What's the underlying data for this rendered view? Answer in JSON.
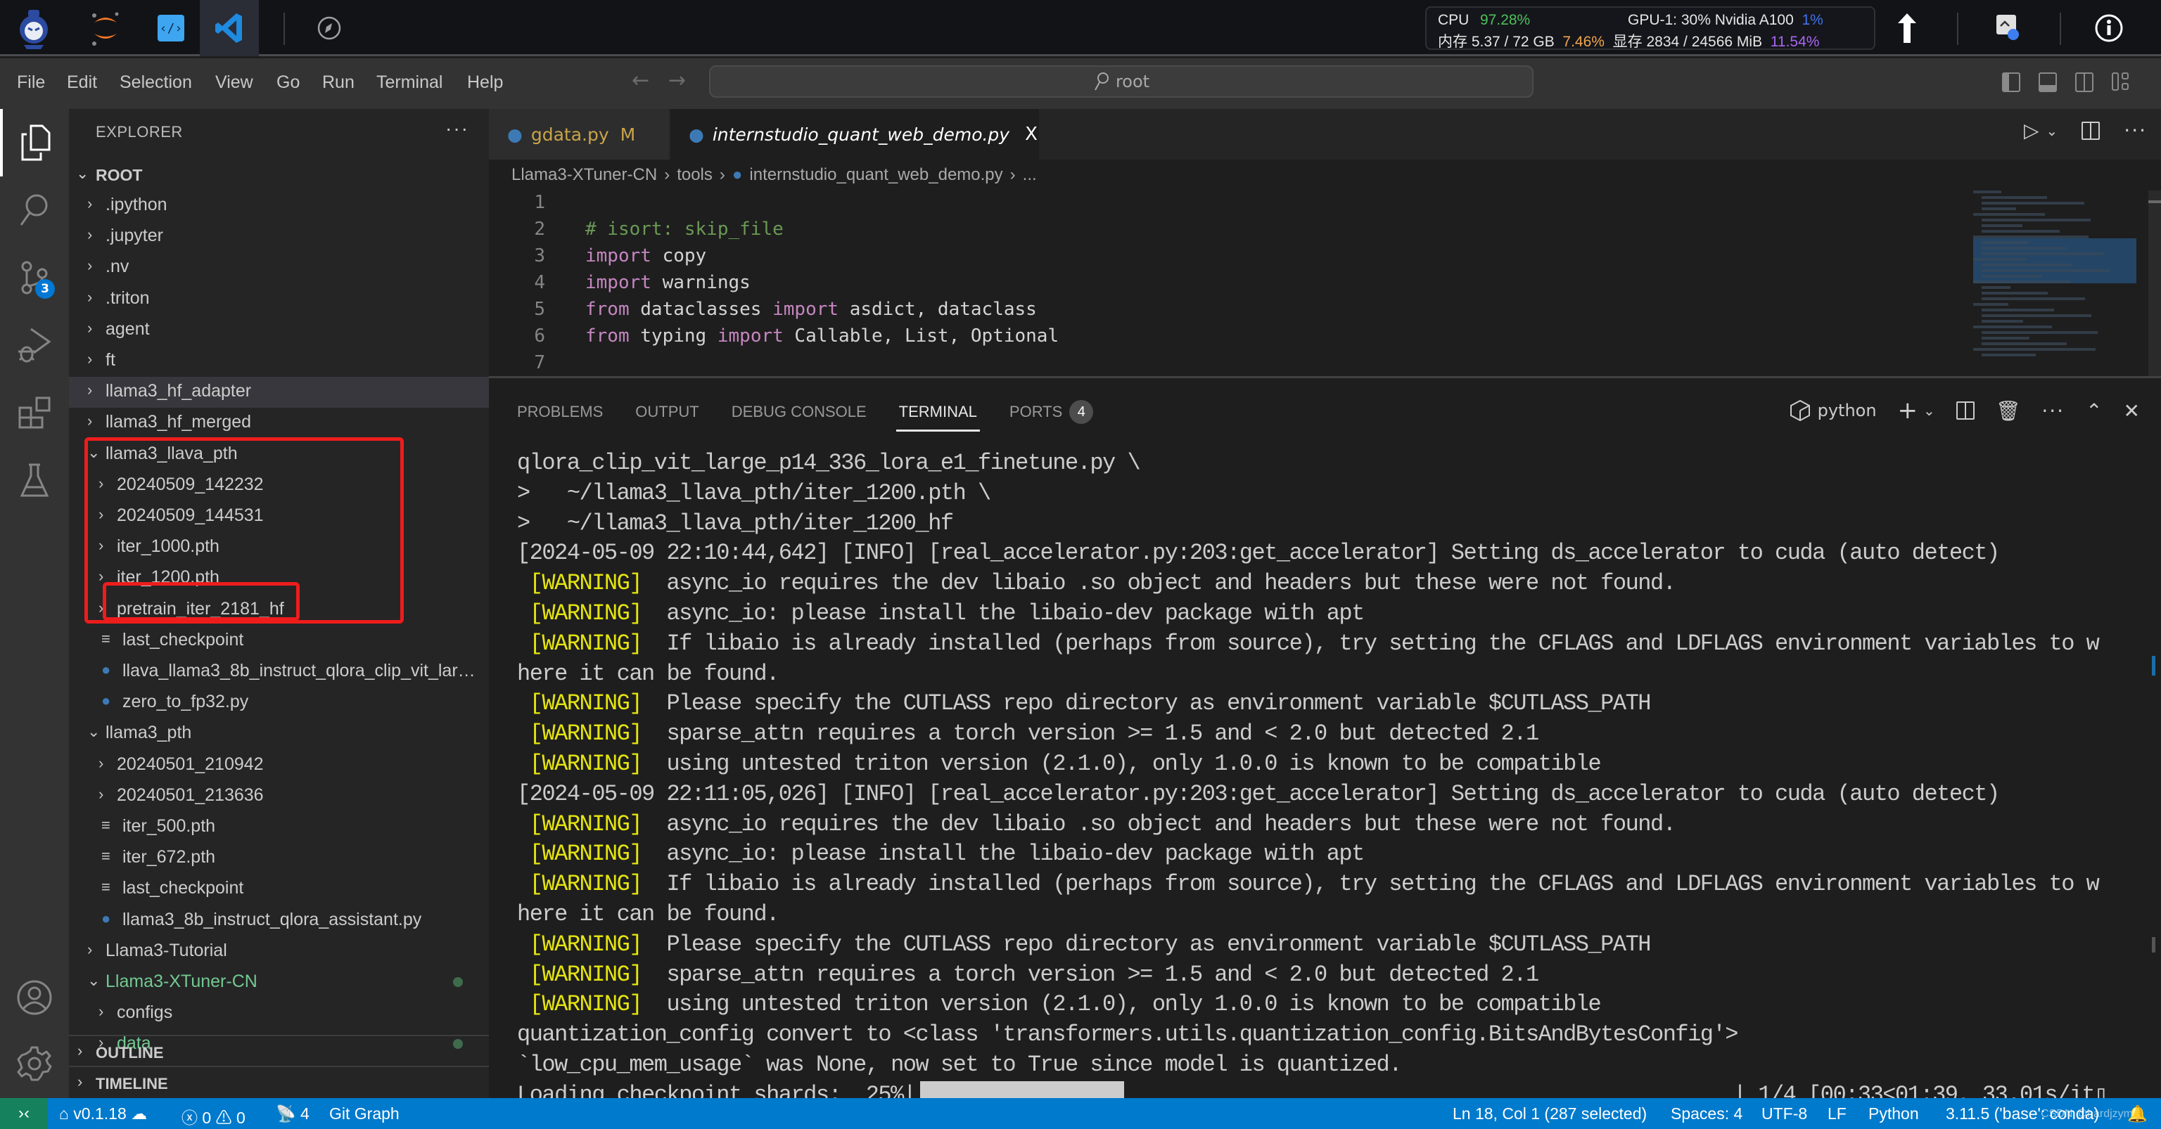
{
  "launcher": {
    "icons": [
      "internstudio-logo-icon",
      "jupyter-icon",
      "code-web-icon",
      "vscode-icon",
      "compass-icon"
    ],
    "active": "vscode-icon",
    "stats": {
      "cpu_label": "CPU",
      "cpu_value": "97.28%",
      "mem_label": "内存 5.37 / 72 GB",
      "mem_value": "7.46%",
      "gpu_label": "GPU-1: 30% Nvidia A100",
      "gpu_value": "1%",
      "vram_label": "显存 2834 / 24566 MiB",
      "vram_value": "11.54%"
    },
    "right_icons": [
      "tensorboard-icon",
      "monitor-icon",
      "info-icon"
    ],
    "colors": {
      "cpu": "#4cc05a",
      "mem": "#f0a64c",
      "gpu": "#3f74f0",
      "vram": "#a966f2"
    }
  },
  "menubar": {
    "items": [
      "File",
      "Edit",
      "Selection",
      "View",
      "Go",
      "Run",
      "Terminal",
      "Help"
    ],
    "search_text": "root"
  },
  "activity_bar": {
    "items": [
      "explorer",
      "search",
      "source-control",
      "run-debug",
      "extensions",
      "testing"
    ],
    "scm_badge": "3",
    "bottom": [
      "accounts",
      "manage"
    ]
  },
  "sidebar": {
    "title": "EXPLORER",
    "root_label": "ROOT",
    "tree": [
      {
        "label": ".ipython",
        "type": "folder",
        "depth": 1,
        "expanded": false
      },
      {
        "label": ".jupyter",
        "type": "folder",
        "depth": 1,
        "expanded": false
      },
      {
        "label": ".nv",
        "type": "folder",
        "depth": 1,
        "expanded": false
      },
      {
        "label": ".triton",
        "type": "folder",
        "depth": 1,
        "expanded": false
      },
      {
        "label": "agent",
        "type": "folder",
        "depth": 1,
        "expanded": false
      },
      {
        "label": "ft",
        "type": "folder",
        "depth": 1,
        "expanded": false
      },
      {
        "label": "llama3_hf_adapter",
        "type": "folder",
        "depth": 1,
        "expanded": false,
        "hover": true
      },
      {
        "label": "llama3_hf_merged",
        "type": "folder",
        "depth": 1,
        "expanded": false
      },
      {
        "label": "llama3_llava_pth",
        "type": "folder",
        "depth": 1,
        "expanded": true
      },
      {
        "label": "20240509_142232",
        "type": "folder",
        "depth": 2,
        "expanded": false
      },
      {
        "label": "20240509_144531",
        "type": "folder",
        "depth": 2,
        "expanded": false
      },
      {
        "label": "iter_1000.pth",
        "type": "folder",
        "depth": 2,
        "expanded": false
      },
      {
        "label": "iter_1200.pth",
        "type": "folder",
        "depth": 2,
        "expanded": false
      },
      {
        "label": "pretrain_iter_2181_hf",
        "type": "folder",
        "depth": 2,
        "expanded": false
      },
      {
        "label": "last_checkpoint",
        "type": "file",
        "depth": 2
      },
      {
        "label": "llava_llama3_8b_instruct_qlora_clip_vit_larg...",
        "type": "python",
        "depth": 2
      },
      {
        "label": "zero_to_fp32.py",
        "type": "python",
        "depth": 2
      },
      {
        "label": "llama3_pth",
        "type": "folder",
        "depth": 1,
        "expanded": true
      },
      {
        "label": "20240501_210942",
        "type": "folder",
        "depth": 2,
        "expanded": false
      },
      {
        "label": "20240501_213636",
        "type": "folder",
        "depth": 2,
        "expanded": false
      },
      {
        "label": "iter_500.pth",
        "type": "file",
        "depth": 2
      },
      {
        "label": "iter_672.pth",
        "type": "file",
        "depth": 2
      },
      {
        "label": "last_checkpoint",
        "type": "file",
        "depth": 2
      },
      {
        "label": "llama3_8b_instruct_qlora_assistant.py",
        "type": "python",
        "depth": 2
      },
      {
        "label": "Llama3-Tutorial",
        "type": "folder",
        "depth": 1,
        "expanded": false
      },
      {
        "label": "Llama3-XTuner-CN",
        "type": "folder",
        "depth": 1,
        "expanded": true,
        "git": "modified"
      },
      {
        "label": "configs",
        "type": "folder",
        "depth": 2,
        "expanded": false
      },
      {
        "label": "data",
        "type": "folder",
        "depth": 2,
        "expanded": false,
        "git": "modified"
      }
    ],
    "sections": [
      "OUTLINE",
      "TIMELINE"
    ],
    "highlight_color": "#ee1c1c"
  },
  "editor": {
    "tabs": [
      {
        "label": "gdata.py",
        "status": "M",
        "active": false
      },
      {
        "label": "internstudio_quant_web_demo.py",
        "active": true,
        "close": "X"
      }
    ],
    "breadcrumb": [
      "Llama3-XTuner-CN",
      "tools",
      "internstudio_quant_web_demo.py",
      "..."
    ],
    "lines": [
      {
        "n": "1",
        "tokens": []
      },
      {
        "n": "2",
        "tokens": [
          {
            "t": "# isort: skip_file",
            "c": "comment"
          }
        ]
      },
      {
        "n": "3",
        "tokens": [
          {
            "t": "import",
            "c": "kw"
          },
          {
            "t": " copy",
            "c": "id"
          }
        ]
      },
      {
        "n": "4",
        "tokens": [
          {
            "t": "import",
            "c": "kw"
          },
          {
            "t": " warnings",
            "c": "id"
          }
        ]
      },
      {
        "n": "5",
        "tokens": [
          {
            "t": "from",
            "c": "kw"
          },
          {
            "t": " dataclasses ",
            "c": "id"
          },
          {
            "t": "import",
            "c": "kw"
          },
          {
            "t": " asdict, dataclass",
            "c": "id"
          }
        ]
      },
      {
        "n": "6",
        "tokens": [
          {
            "t": "from",
            "c": "kw"
          },
          {
            "t": " typing ",
            "c": "id"
          },
          {
            "t": "import",
            "c": "kw"
          },
          {
            "t": " Callable, List, Optional",
            "c": "id"
          }
        ]
      },
      {
        "n": "7",
        "tokens": []
      }
    ]
  },
  "panel": {
    "tabs": [
      "PROBLEMS",
      "OUTPUT",
      "DEBUG CONSOLE",
      "TERMINAL",
      "PORTS"
    ],
    "active_tab": "TERMINAL",
    "ports_badge": "4",
    "shell": "python",
    "terminal_lines": [
      {
        "text": "qlora_clip_vit_large_p14_336_lora_e1_finetune.py \\"
      },
      {
        "text": ">   ~/llama3_llava_pth/iter_1200.pth \\"
      },
      {
        "text": ">   ~/llama3_llava_pth/iter_1200_hf"
      },
      {
        "text": "[2024-05-09 22:10:44,642] [INFO] [real_accelerator.py:203:get_accelerator] Setting ds_accelerator to cuda (auto detect)"
      },
      {
        "warn": "[WARNING]",
        "text": "  async_io requires the dev libaio .so object and headers but these were not found."
      },
      {
        "warn": "[WARNING]",
        "text": "  async_io: please install the libaio-dev package with apt"
      },
      {
        "warn": "[WARNING]",
        "text": "  If libaio is already installed (perhaps from source), try setting the CFLAGS and LDFLAGS environment variables to w"
      },
      {
        "text": "here it can be found."
      },
      {
        "warn": "[WARNING]",
        "text": "  Please specify the CUTLASS repo directory as environment variable $CUTLASS_PATH"
      },
      {
        "warn": "[WARNING]",
        "text": "  sparse_attn requires a torch version >= 1.5 and < 2.0 but detected 2.1"
      },
      {
        "warn": "[WARNING]",
        "text": "  using untested triton version (2.1.0), only 1.0.0 is known to be compatible"
      },
      {
        "text": "[2024-05-09 22:11:05,026] [INFO] [real_accelerator.py:203:get_accelerator] Setting ds_accelerator to cuda (auto detect)"
      },
      {
        "warn": "[WARNING]",
        "text": "  async_io requires the dev libaio .so object and headers but these were not found."
      },
      {
        "warn": "[WARNING]",
        "text": "  async_io: please install the libaio-dev package with apt"
      },
      {
        "warn": "[WARNING]",
        "text": "  If libaio is already installed (perhaps from source), try setting the CFLAGS and LDFLAGS environment variables to w"
      },
      {
        "text": "here it can be found."
      },
      {
        "warn": "[WARNING]",
        "text": "  Please specify the CUTLASS repo directory as environment variable $CUTLASS_PATH"
      },
      {
        "warn": "[WARNING]",
        "text": "  sparse_attn requires a torch version >= 1.5 and < 2.0 but detected 2.1"
      },
      {
        "warn": "[WARNING]",
        "text": "  using untested triton version (2.1.0), only 1.0.0 is known to be compatible"
      },
      {
        "text": "quantization_config convert to <class 'transformers.utils.quantization_config.BitsAndBytesConfig'>"
      },
      {
        "text": "`low_cpu_mem_usage` was None, now set to True since model is quantized."
      }
    ],
    "progress": {
      "label": "Loading checkpoint shards:  25%",
      "fraction": 0.25,
      "tail": "| 1/4 [00:33<01:39, 33.01s/it"
    }
  },
  "statusbar": {
    "remote_icon": "remote-icon",
    "version": "v0.1.18",
    "errors": "0",
    "warnings": "0",
    "ports": "4",
    "git_graph": "Git Graph",
    "cursor": "Ln 18, Col 1 (287 selected)",
    "spaces": "Spaces: 4",
    "encoding": "UTF-8",
    "eol": "LF",
    "language": "Python",
    "interpreter": "3.11.5 ('base': conda)",
    "watermark": "CSDN @hardjzym"
  }
}
